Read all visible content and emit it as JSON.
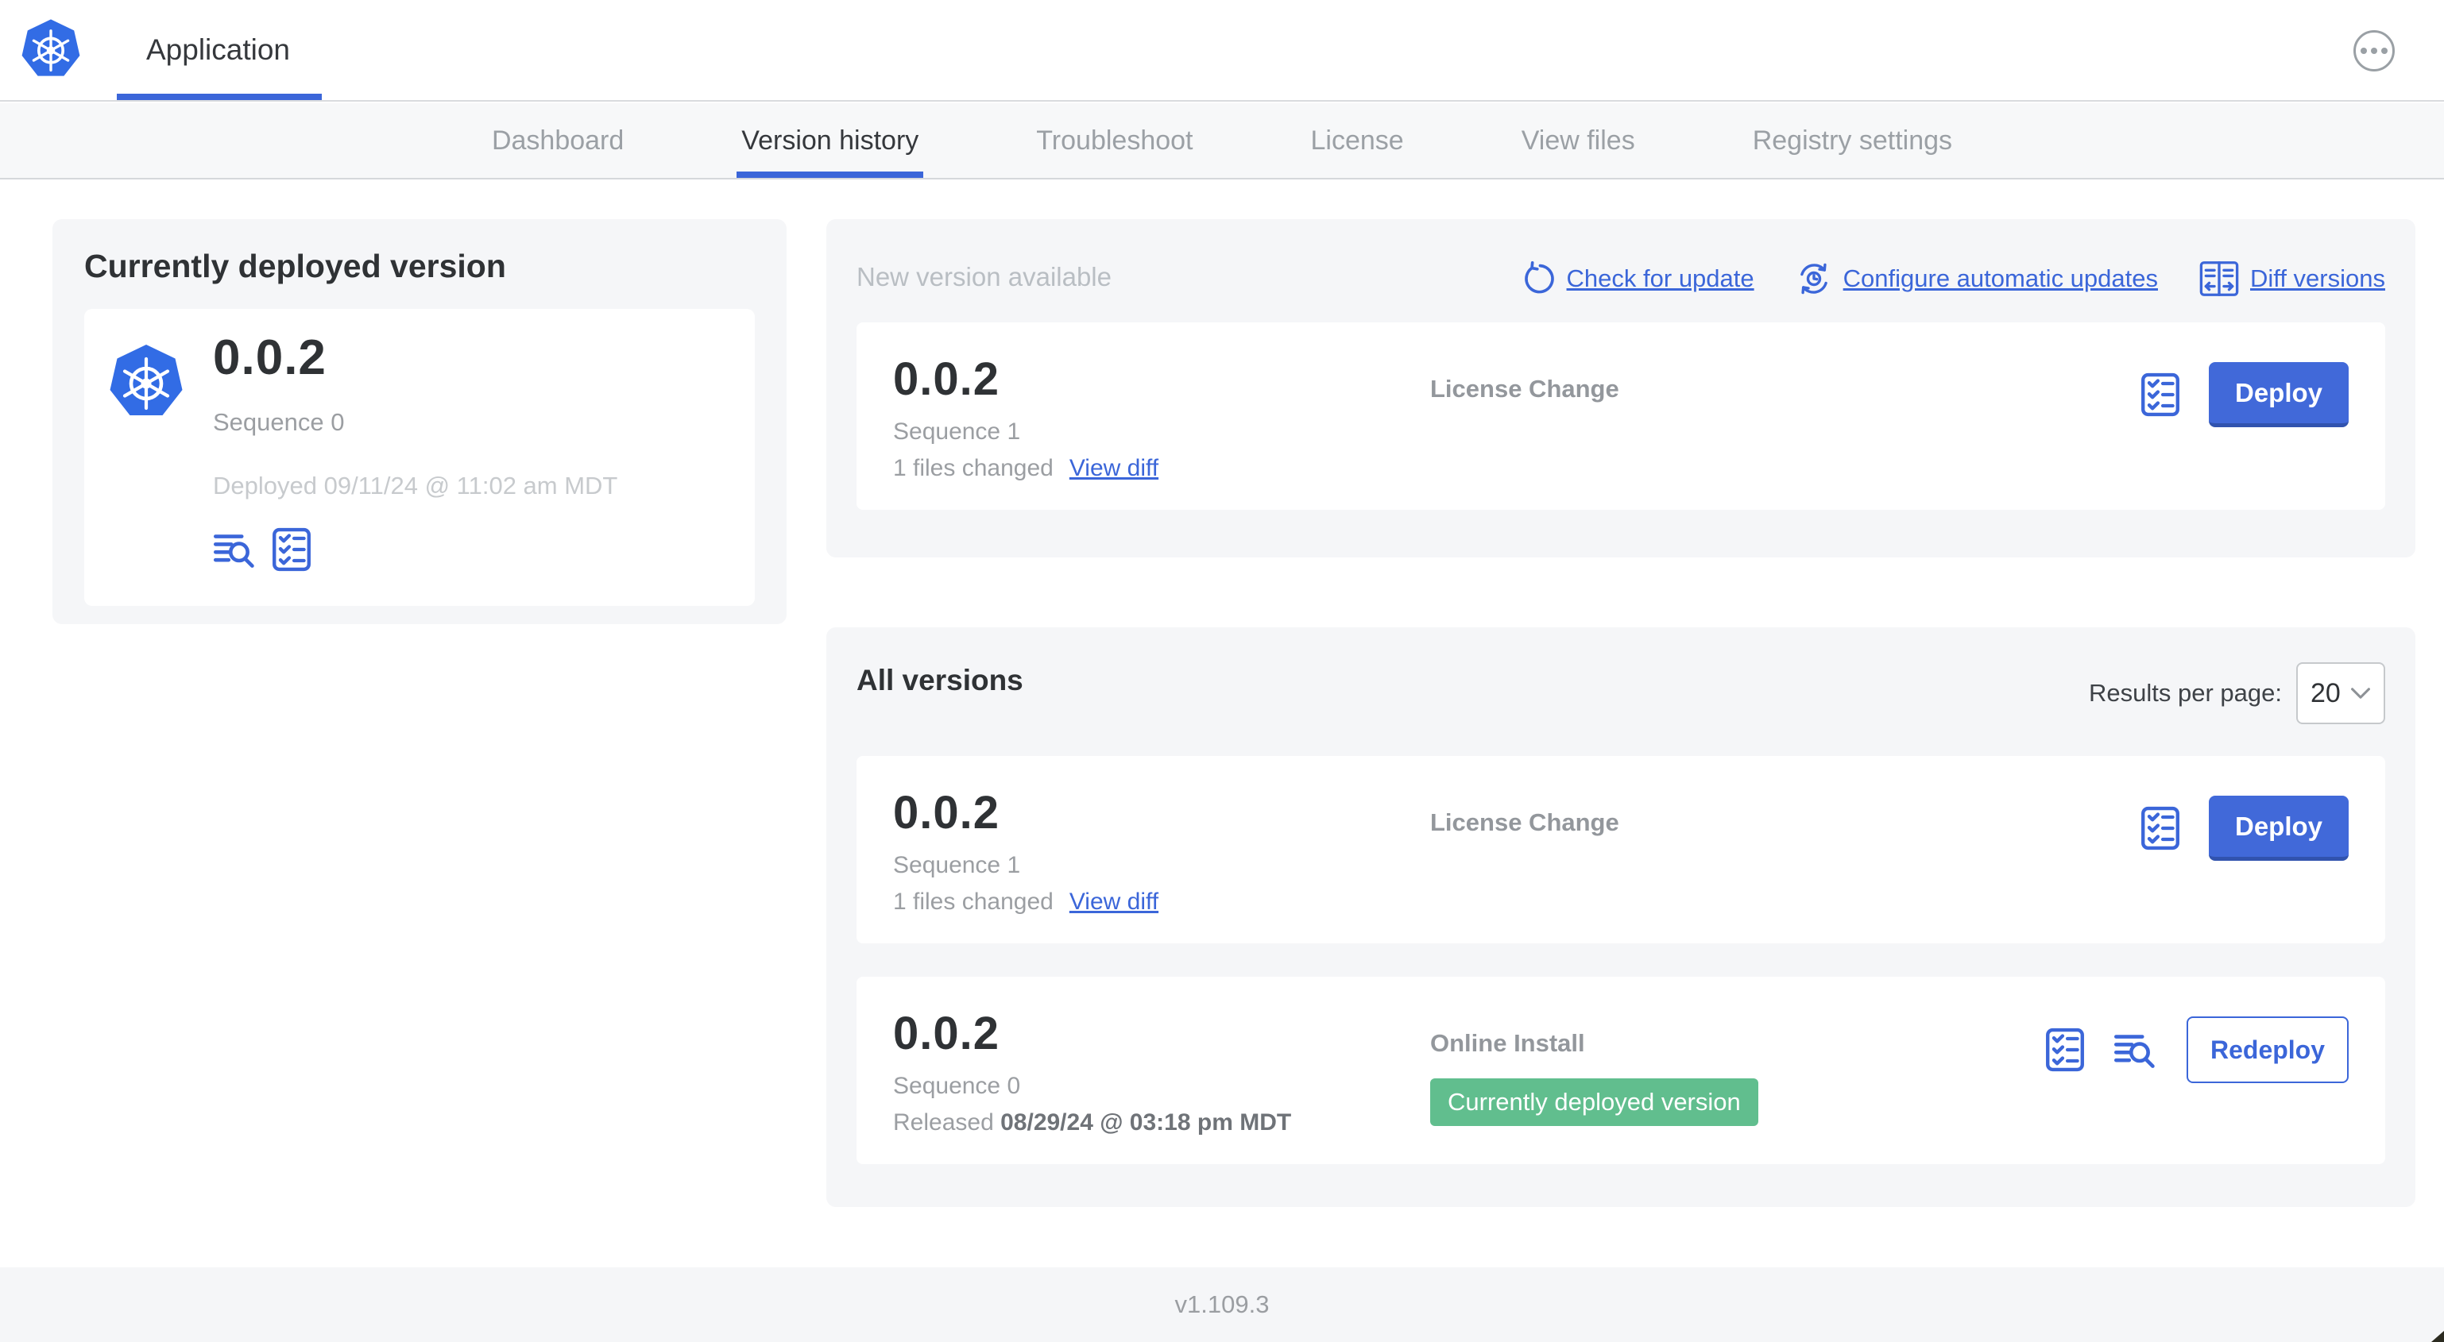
{
  "header": {
    "app_title": "Application"
  },
  "nav": {
    "tabs": [
      {
        "label": "Dashboard",
        "active": false
      },
      {
        "label": "Version history",
        "active": true
      },
      {
        "label": "Troubleshoot",
        "active": false
      },
      {
        "label": "License",
        "active": false
      },
      {
        "label": "View files",
        "active": false
      },
      {
        "label": "Registry settings",
        "active": false
      }
    ]
  },
  "currently_deployed": {
    "title": "Currently deployed version",
    "version": "0.0.2",
    "sequence": "Sequence 0",
    "deployed": "Deployed 09/11/24 @ 11:02 am MDT"
  },
  "new_version": {
    "title": "New version available",
    "actions": {
      "check_for_update": "Check for update",
      "configure_automatic_updates": "Configure automatic updates",
      "diff_versions": "Diff versions"
    },
    "card": {
      "version": "0.0.2",
      "sequence": "Sequence 1",
      "files_changed": "1 files changed",
      "view_diff": "View diff",
      "source": "License Change",
      "deploy_label": "Deploy"
    }
  },
  "all_versions": {
    "title": "All versions",
    "results_per_page_label": "Results per page:",
    "results_per_page_value": "20",
    "rows": [
      {
        "version": "0.0.2",
        "sequence": "Sequence 1",
        "files_changed": "1 files changed",
        "view_diff": "View diff",
        "source": "License Change",
        "action_label": "Deploy"
      },
      {
        "version": "0.0.2",
        "sequence": "Sequence 0",
        "released_prefix": "Released",
        "released_date": "08/29/24 @ 03:18 pm MDT",
        "source": "Online Install",
        "badge": "Currently deployed version",
        "action_label": "Redeploy"
      }
    ]
  },
  "footer": {
    "app_manager_version": "v1.109.3"
  },
  "colors": {
    "accent_blue": "#3b66d9",
    "button_blue": "#4169d9",
    "kubernetes_blue": "#326ce5",
    "badge_green": "#61be8e",
    "panel_gray": "#f5f6f8"
  }
}
